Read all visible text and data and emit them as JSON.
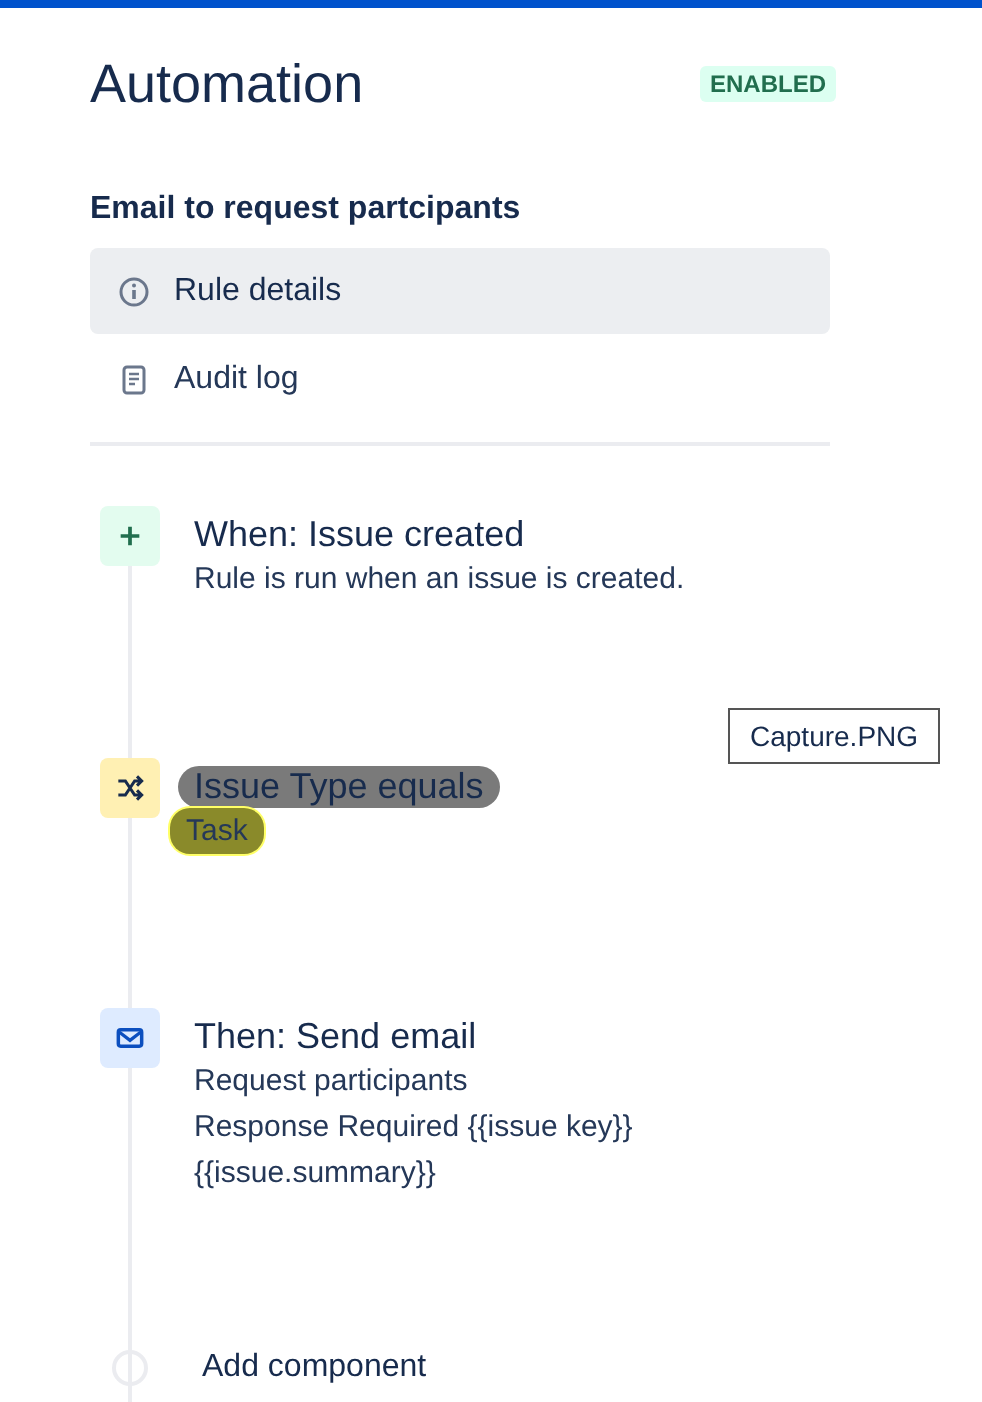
{
  "header": {
    "title": "Automation",
    "status": "ENABLED"
  },
  "rule_name": "Email to request partcipants",
  "nav": [
    {
      "label": "Rule details",
      "kind": "info",
      "selected": true
    },
    {
      "label": "Audit log",
      "kind": "log",
      "selected": false
    }
  ],
  "steps": [
    {
      "kind": "trigger",
      "title": "When: Issue created",
      "lines": [
        "Rule is run when an issue is created."
      ]
    },
    {
      "kind": "condition",
      "title": "Issue Type equals",
      "lines": [
        "Task"
      ]
    },
    {
      "kind": "action",
      "title": "Then: Send email",
      "lines": [
        "Request participants",
        "Response Required {{issue key}}",
        "{{issue.summary}}"
      ]
    }
  ],
  "add_component": "Add component",
  "tooltip": "Capture.PNG"
}
